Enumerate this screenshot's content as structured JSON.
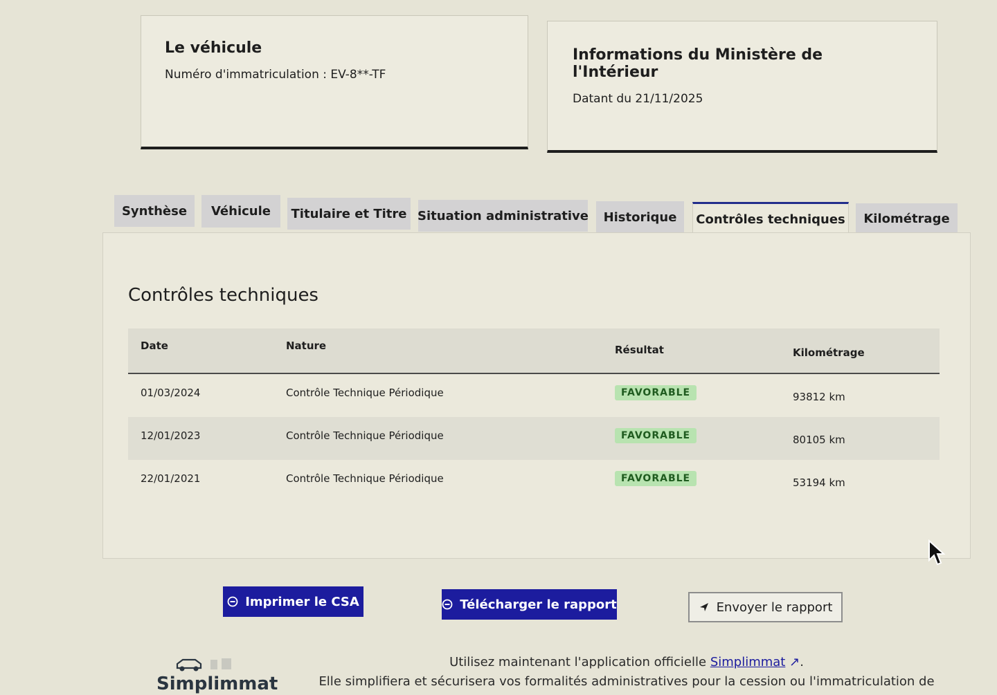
{
  "vehicle_card": {
    "title": "Le véhicule",
    "plate_line": "Numéro d'immatriculation : EV-8**-TF"
  },
  "ministry_card": {
    "title": "Informations du Ministère de l'Intérieur",
    "date_line": "Datant du 21/11/2025"
  },
  "tabs": [
    {
      "label": "Synthèse"
    },
    {
      "label": "Véhicule"
    },
    {
      "label": "Titulaire et Titre"
    },
    {
      "label": "Situation administrative"
    },
    {
      "label": "Historique"
    },
    {
      "label": "Contrôles techniques",
      "active": true
    },
    {
      "label": "Kilométrage"
    }
  ],
  "panel": {
    "title": "Contrôles techniques",
    "columns": [
      "Date",
      "Nature",
      "Résultat",
      "Kilométrage"
    ],
    "rows": [
      {
        "date": "01/03/2024",
        "nature": "Contrôle Technique Périodique",
        "result": "FAVORABLE",
        "km": "93812 km"
      },
      {
        "date": "12/01/2023",
        "nature": "Contrôle Technique Périodique",
        "result": "FAVORABLE",
        "km": "80105 km"
      },
      {
        "date": "22/01/2021",
        "nature": "Contrôle Technique Périodique",
        "result": "FAVORABLE",
        "km": "53194 km"
      }
    ]
  },
  "actions": {
    "print": "Imprimer le CSA",
    "download": "Télécharger le rapport",
    "send": "Envoyer le rapport"
  },
  "footer": {
    "logo_text": "Simplimmat",
    "line1_prefix": "Utilisez maintenant l'application officielle",
    "link": "Simplimmat",
    "line1_suffix": ".",
    "line2": "Elle simplifiera et sécurisera vos formalités administratives pour la cession ou l'immatriculation de"
  },
  "colors": {
    "primary": "#1c1c9e",
    "badge_bg": "#b8e3b0",
    "badge_text": "#1f5b1f"
  }
}
